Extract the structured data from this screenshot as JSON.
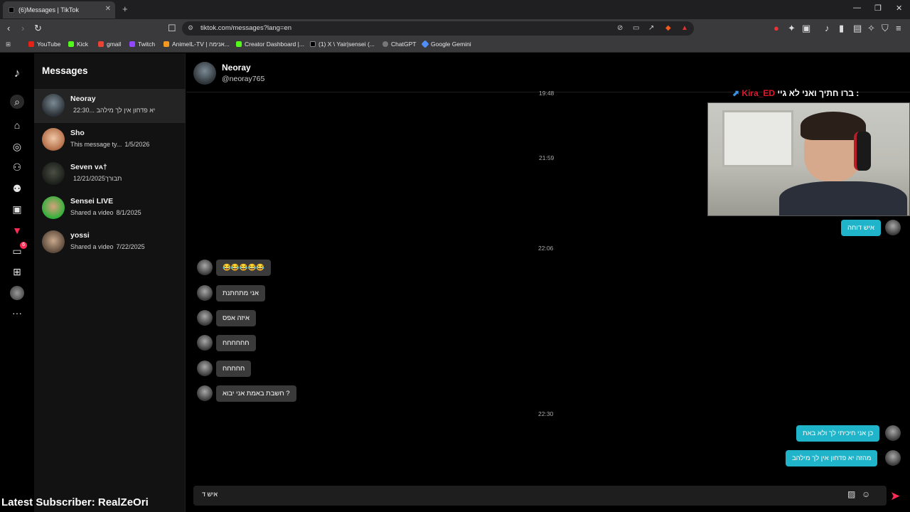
{
  "browser": {
    "tab_title": "(6)Messages | TikTok",
    "url": "tiktok.com/messages?lang=en",
    "bookmarks": [
      "YouTube",
      "Kick",
      "gmail",
      "Twitch",
      "AnimeIL-TV | אנימה...",
      "Creator Dashboard |...",
      "(1) X \\ Yair|sensei (...",
      "ChatGPT",
      "Google Gemini"
    ]
  },
  "rail": {
    "messages_badge": "6"
  },
  "panel": {
    "title": "Messages"
  },
  "conversations": [
    {
      "name": "Neoray",
      "preview": "יא פדחון אין לך מילהב ...",
      "time": "22:30"
    },
    {
      "name": "Sho",
      "preview": "This message ty...",
      "time": "1/5/2026"
    },
    {
      "name": "Seven ᴠᴀ†",
      "preview": "תבורך",
      "time": "12/21/2025"
    },
    {
      "name": "Sensei LIVE",
      "preview": "Shared a video",
      "time": "8/1/2025"
    },
    {
      "name": "yossi",
      "preview": "Shared a video",
      "time": "7/22/2025"
    }
  ],
  "chat": {
    "name": "Neoray",
    "username": "@neoray765",
    "timestamps": [
      "19:48",
      "21:59",
      "22:06",
      "22:30"
    ],
    "messages_sent_1": "איש דוחה",
    "incoming": [
      "😂😂😂😂😂",
      "אני מתחתנת",
      "איזה אפס",
      "חחחחחח",
      "חחחחח",
      "חשבת באמת אני יבוא ?"
    ],
    "messages_sent_2": [
      "כן אני חיכיתי לך ולא באת",
      "מהזה יא  פדחון אין לך מילהב"
    ],
    "composer_value": "איש ד"
  },
  "overlay": {
    "top_text": "ברו חתיך ואני לא גיי :",
    "top_name": "Kira_ED",
    "subscriber": "Latest Subscriber: RealZeOri"
  }
}
